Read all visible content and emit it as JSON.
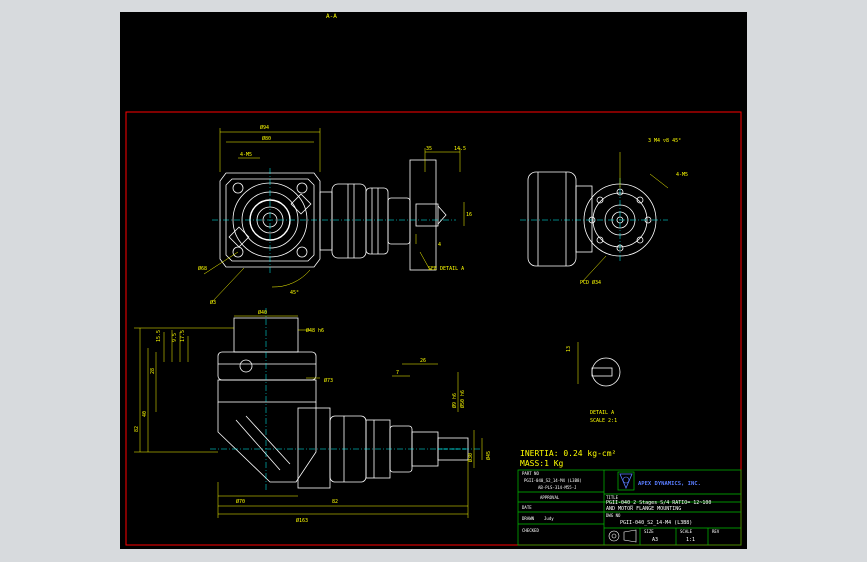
{
  "colors": {
    "app_background": "#d7dadd",
    "canvas_background": "#000000",
    "border_red": "#ff0000",
    "outline_white": "#ffffff",
    "dimension_yellow": "#ffff00",
    "centerline_cyan": "#00ffff",
    "titleblock_green": "#00c000",
    "logo_text": "#5a7dff"
  },
  "drawing": {
    "top_mark": "A-A",
    "top_view": {
      "dim_overall_width": "Ø94",
      "dim_flange_width": "Ø80",
      "dim_offset": "4-M5",
      "dim_pcd": "Ø68",
      "dim_bore": "Ø3",
      "dim_angle": "45°",
      "dim_shaft_len": "35",
      "dim_shaft_step": "14.5",
      "dim_shaft_dia": "16",
      "dim_key": "4",
      "detail_callout": "SEE DETAIL A"
    },
    "side_view": {
      "dim_thread": "3 M4 ▽8 45°",
      "dim_holes": "4-M5",
      "dim_pcd": "PCD Ø34"
    },
    "front_view": {
      "dim_flange": "Ø40",
      "dim_pilot": "Ø48 h6",
      "dim_body": "Ø73",
      "dim_h1": "15.5",
      "dim_h2": "9.5",
      "dim_h3": "17.5",
      "dim_h4": "82",
      "dim_h5": "40",
      "dim_h6": "28",
      "dim_v1": "26",
      "dim_v2": "7",
      "dim_v3": "Ø9 h6",
      "dim_v4": "Ø50 h6",
      "dim_v5": "Ø30",
      "dim_v6": "Ø45",
      "dim_bottom1": "Ø70",
      "dim_bottom2": "82",
      "dim_bottom_total": "Ø163"
    },
    "detail_view": {
      "dim": "13",
      "label": "DETAIL A",
      "scale": "SCALE 2:1"
    },
    "notes": {
      "inertia": "INERTIA: 0.24 kg-cm²",
      "mass": "MASS:1 Kg"
    },
    "title_block": {
      "ref_header": "PART NO",
      "ref_model": "PGII-040_S2_14-M4 (L3B8)",
      "ref_doc": "AB-PLS-314-M55-J",
      "approved_label": "APPROVAL",
      "date_label": "DATE",
      "drawn_label": "DRAWN",
      "drawn_by": "Judy",
      "checked_label": "CHECKED",
      "company": "APEX DYNAMICS, INC.",
      "title_label": "TITLE",
      "title_line1": "PGII-040_2 Stages S/4  RATIO= 12~100",
      "title_line2": "AND MOTOR FLANGE MOUNTING",
      "dwg_label": "DWG NO",
      "dwg_no": "PGII-040_S2_14-M4 (L3B8)",
      "size_label": "SIZE",
      "size": "A3",
      "scale_label": "SCALE",
      "scale": "1:1",
      "rev_label": "REV",
      "rev": ""
    }
  }
}
